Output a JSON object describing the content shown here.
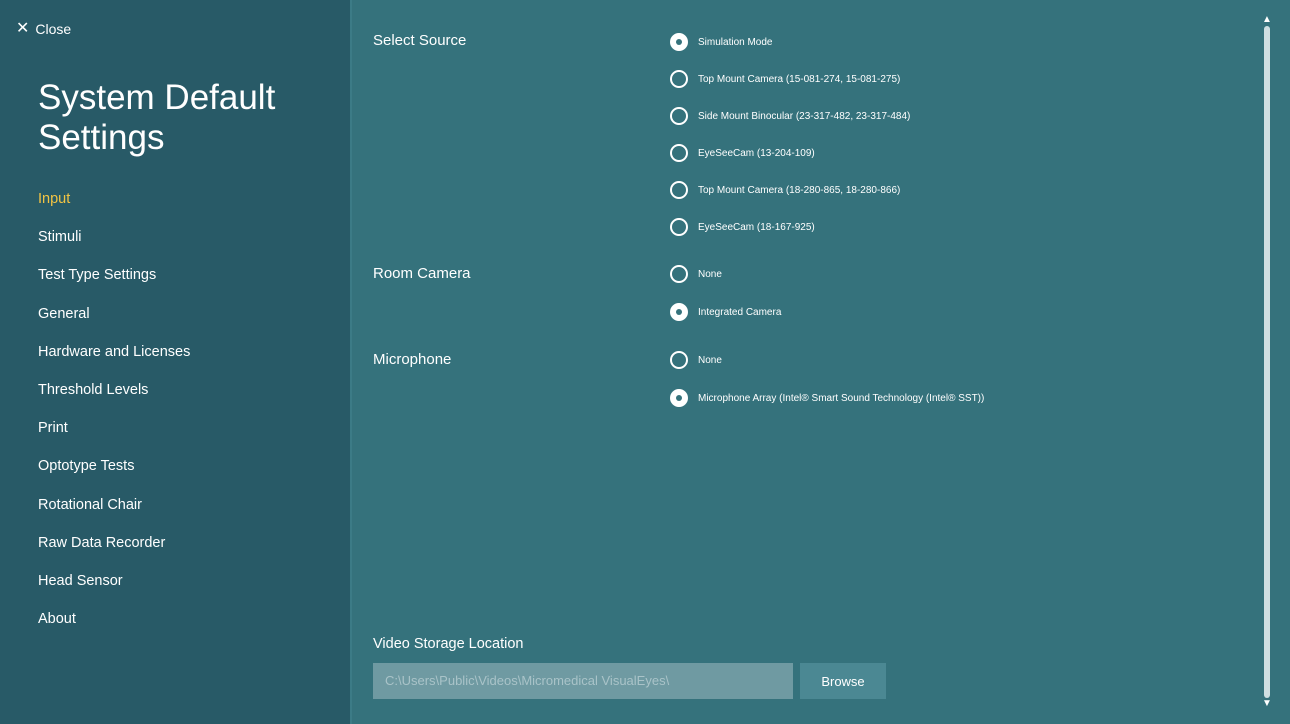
{
  "close": {
    "label": "Close"
  },
  "title": "System Default Settings",
  "nav": [
    {
      "label": "Input",
      "active": true
    },
    {
      "label": "Stimuli"
    },
    {
      "label": "Test Type Settings"
    },
    {
      "label": "General"
    },
    {
      "label": "Hardware and Licenses"
    },
    {
      "label": "Threshold Levels"
    },
    {
      "label": "Print"
    },
    {
      "label": "Optotype Tests"
    },
    {
      "label": "Rotational Chair"
    },
    {
      "label": "Raw Data Recorder"
    },
    {
      "label": "Head Sensor"
    },
    {
      "label": "About"
    }
  ],
  "select_source": {
    "label": "Select Source",
    "options": [
      {
        "label": "Simulation Mode",
        "checked": true
      },
      {
        "label": "Top Mount Camera  (15-081-274, 15-081-275)",
        "checked": false
      },
      {
        "label": "Side Mount Binocular  (23-317-482, 23-317-484)",
        "checked": false
      },
      {
        "label": "EyeSeeCam  (13-204-109)",
        "checked": false
      },
      {
        "label": "Top Mount Camera  (18-280-865, 18-280-866)",
        "checked": false
      },
      {
        "label": "EyeSeeCam  (18-167-925)",
        "checked": false
      }
    ]
  },
  "room_camera": {
    "label": "Room Camera",
    "options": [
      {
        "label": "None",
        "checked": false
      },
      {
        "label": "Integrated Camera",
        "checked": true
      }
    ]
  },
  "microphone": {
    "label": "Microphone",
    "options": [
      {
        "label": "None",
        "checked": false
      },
      {
        "label": "Microphone Array (Intel® Smart Sound Technology (Intel® SST))",
        "checked": true
      }
    ]
  },
  "video_storage": {
    "label": "Video Storage Location",
    "path": "C:\\Users\\Public\\Videos\\Micromedical VisualEyes\\",
    "browse_label": "Browse"
  }
}
